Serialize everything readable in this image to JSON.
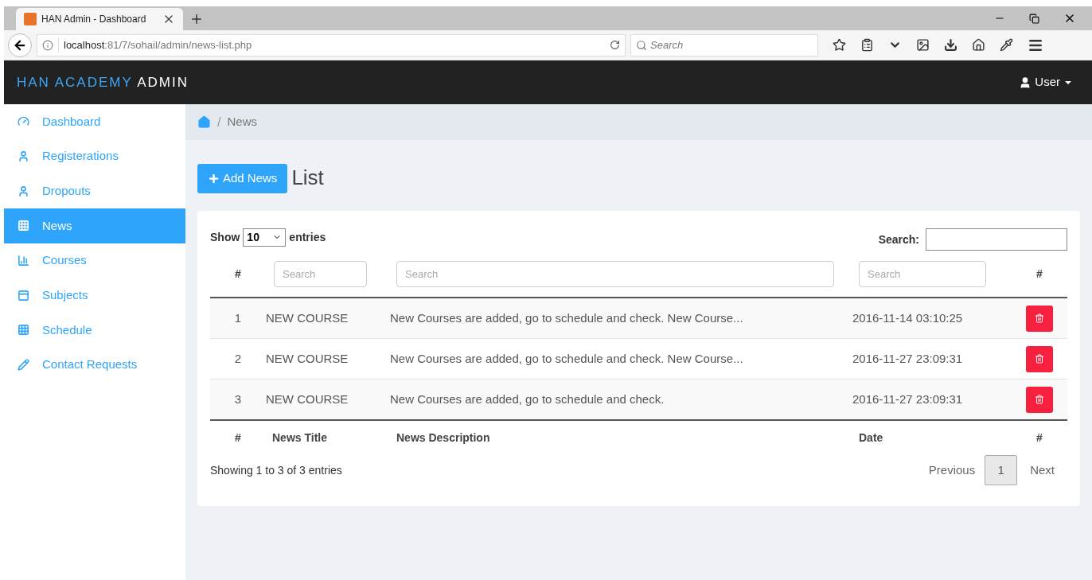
{
  "browser": {
    "tab_title": "HAN Admin - Dashboard",
    "url_host": "localhost",
    "url_path": ":81/7/sohail/admin/news-list.php",
    "search_placeholder": "Search"
  },
  "navbar": {
    "brand_highlight": "HAN ACADEMY",
    "brand_rest": "ADMIN",
    "user": "User"
  },
  "sidebar": {
    "items": [
      {
        "label": "Dashboard",
        "selected": false
      },
      {
        "label": "Registerations",
        "selected": false
      },
      {
        "label": "Dropouts",
        "selected": false
      },
      {
        "label": "News",
        "selected": true
      },
      {
        "label": "Courses",
        "selected": false
      },
      {
        "label": "Subjects",
        "selected": false
      },
      {
        "label": "Schedule",
        "selected": false
      },
      {
        "label": "Contact Requests",
        "selected": false
      }
    ]
  },
  "breadcrumb": {
    "separator": "/",
    "current": "News"
  },
  "page": {
    "add_button": "Add News",
    "heading": "List"
  },
  "table": {
    "length_label": "Show",
    "length_value": "10",
    "length_suffix": "entries",
    "search_label": "Search:",
    "filters": [
      {
        "kind": "text",
        "label": "#"
      },
      {
        "kind": "filter",
        "placeholder": "Search"
      },
      {
        "kind": "filter",
        "placeholder": "Search"
      },
      {
        "kind": "filter",
        "placeholder": "Search"
      },
      {
        "kind": "text",
        "label": "#"
      }
    ],
    "rows": [
      {
        "number": "1",
        "title": "NEW COURSE",
        "description": "New Courses are added, go to schedule and check. New Course...",
        "date": "2016-11-14 03:10:25"
      },
      {
        "number": "2",
        "title": "NEW COURSE",
        "description": "New Courses are added, go to schedule and check. New Course...",
        "date": "2016-11-27 23:09:31"
      },
      {
        "number": "3",
        "title": "NEW COURSE",
        "description": "New Courses are added, go to schedule and check.",
        "date": "2016-11-27 23:09:31"
      }
    ],
    "footer_columns": [
      "#",
      "News Title",
      "News Description",
      "Date",
      "#"
    ],
    "info": "Showing 1 to 3 of 3 entries",
    "pagination": {
      "previous": "Previous",
      "pages": [
        {
          "label": "1",
          "selected": true
        }
      ],
      "next": "Next"
    }
  }
}
